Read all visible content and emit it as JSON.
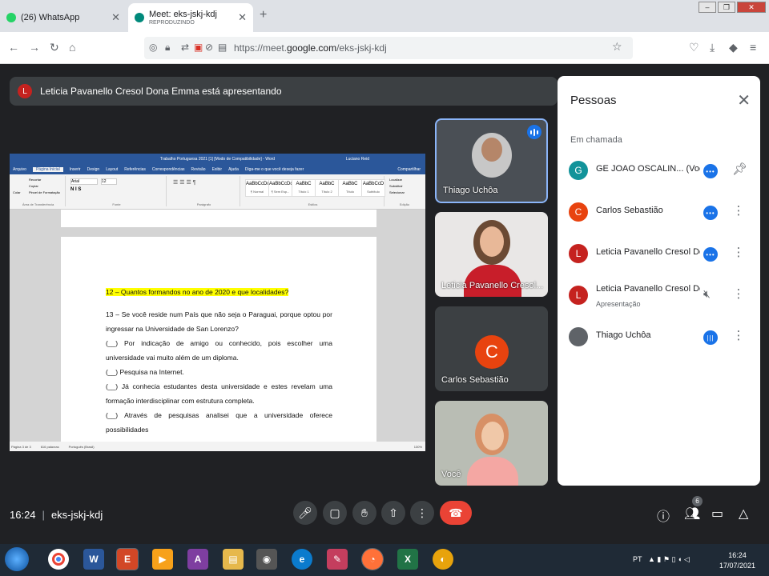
{
  "browser": {
    "tabs": [
      {
        "title": "(26) WhatsApp",
        "active": false,
        "favicon_color": "#25d366"
      },
      {
        "title": "Meet: eks-jskj-kdj",
        "subtitle": "REPRODUZINDO",
        "active": true,
        "favicon_color": "#00897b"
      }
    ],
    "new_tab": "+",
    "url_domain": "https://meet.",
    "url_host": "google.com",
    "url_path": "/eks-jskj-kdj"
  },
  "meet": {
    "presenting_initial": "L",
    "presenting_text": "Leticia Pavanello Cresol Dona Emma está apresentando",
    "time": "16:24",
    "meeting_code": "eks-jskj-kdj",
    "participant_count": "6",
    "end_color": "#ea4335",
    "accent": "#1a73e8"
  },
  "word": {
    "title": "Trabalho Portuguesa 2021 [1] [Modo de Compatibilidade] - Word",
    "user": "Luciano Reid",
    "tabs": [
      "Arquivo",
      "Página Inicial",
      "Inserir",
      "Design",
      "Layout",
      "Referências",
      "Correspondências",
      "Revisão",
      "Exibir",
      "Ajuda",
      "Diga-me o que você deseja fazer",
      "Compartilhar"
    ],
    "font": "Arial",
    "font_size": "12",
    "groups": [
      "Área de Transferência",
      "Fonte",
      "Parágrafo",
      "Estilos",
      "Edição"
    ],
    "clipboard": [
      "Recortar",
      "Copiar",
      "Pincel de Formatação",
      "Colar"
    ],
    "edit": [
      "Localizar",
      "Substituir",
      "Selecionar"
    ],
    "styles": [
      {
        "sample": "AaBbCcDc",
        "name": "¶ Normal"
      },
      {
        "sample": "AaBbCcDc",
        "name": "¶ Sem Esp..."
      },
      {
        "sample": "AaBbC",
        "name": "Título 1"
      },
      {
        "sample": "AaBbC",
        "name": "Título 2"
      },
      {
        "sample": "AaBbC",
        "name": "Título"
      },
      {
        "sample": "AaBbCcD",
        "name": "Subtítulo"
      }
    ],
    "doc": {
      "q12": "12 – Quantos formandos no ano de 2020 e que localidades?",
      "q13": "13 – Se você reside num País que não seja o Paraguai, porque optou por ingressar na Universidade de San Lorenzo?",
      "opt1": "(__) Por indicação de amigo ou conhecido, pois escolher uma universidade vai muito além de um diploma.",
      "opt2": "(__) Pesquisa na Internet.",
      "opt3": "(__) Já conhecia estudantes desta universidade e estes revelam uma formação interdisciplinar com estrutura completa.",
      "opt4": "(__) Através de pesquisas analisei que a universidade oferece possibilidades"
    },
    "status": [
      "Página 3 de 3",
      "616 palavras",
      "Português (Brasil)",
      "130%"
    ]
  },
  "tiles": [
    {
      "name": "Thiago Uchôa",
      "speaking": true
    },
    {
      "name": "Leticia Pavanello Cresol...",
      "speaking": false
    },
    {
      "name": "Carlos Sebastião",
      "initial": "C",
      "speaking": false
    },
    {
      "name": "Você",
      "speaking": false
    }
  ],
  "panel": {
    "title": "Pessoas",
    "section": "Em chamada",
    "people": [
      {
        "initial": "G",
        "name": "GE JOAO OSCALIN... (Você)",
        "color": "#12939a",
        "status": "",
        "action": "pin"
      },
      {
        "initial": "C",
        "name": "Carlos Sebastião",
        "color": "#e8430f",
        "status": "",
        "action": "more"
      },
      {
        "initial": "L",
        "name": "Leticia Pavanello Cresol Do...",
        "color": "#c5221f",
        "status": "",
        "action": "more"
      },
      {
        "initial": "L",
        "name": "Leticia Pavanello Cresol Do...",
        "color": "#c5221f",
        "status": "Apresentação",
        "action": "more"
      },
      {
        "initial": "",
        "name": "Thiago Uchôa",
        "color": "#5f6368",
        "status": "",
        "action": "more"
      }
    ]
  },
  "taskbar": {
    "lang": "PT",
    "time": "16:24",
    "date": "17/07/2021"
  }
}
